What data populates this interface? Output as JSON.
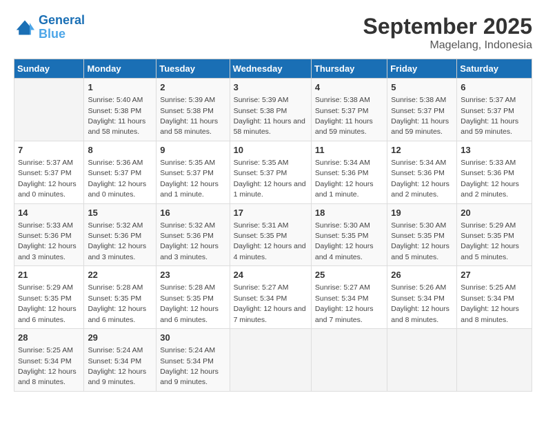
{
  "header": {
    "logo_general": "General",
    "logo_blue": "Blue",
    "month_year": "September 2025",
    "location": "Magelang, Indonesia"
  },
  "days_of_week": [
    "Sunday",
    "Monday",
    "Tuesday",
    "Wednesday",
    "Thursday",
    "Friday",
    "Saturday"
  ],
  "weeks": [
    [
      {
        "day": "",
        "sunrise": "",
        "sunset": "",
        "daylight": ""
      },
      {
        "day": "1",
        "sunrise": "5:40 AM",
        "sunset": "5:38 PM",
        "daylight": "11 hours and 58 minutes."
      },
      {
        "day": "2",
        "sunrise": "5:39 AM",
        "sunset": "5:38 PM",
        "daylight": "11 hours and 58 minutes."
      },
      {
        "day": "3",
        "sunrise": "5:39 AM",
        "sunset": "5:38 PM",
        "daylight": "11 hours and 58 minutes."
      },
      {
        "day": "4",
        "sunrise": "5:38 AM",
        "sunset": "5:37 PM",
        "daylight": "11 hours and 59 minutes."
      },
      {
        "day": "5",
        "sunrise": "5:38 AM",
        "sunset": "5:37 PM",
        "daylight": "11 hours and 59 minutes."
      },
      {
        "day": "6",
        "sunrise": "5:37 AM",
        "sunset": "5:37 PM",
        "daylight": "11 hours and 59 minutes."
      }
    ],
    [
      {
        "day": "7",
        "sunrise": "5:37 AM",
        "sunset": "5:37 PM",
        "daylight": "12 hours and 0 minutes."
      },
      {
        "day": "8",
        "sunrise": "5:36 AM",
        "sunset": "5:37 PM",
        "daylight": "12 hours and 0 minutes."
      },
      {
        "day": "9",
        "sunrise": "5:35 AM",
        "sunset": "5:37 PM",
        "daylight": "12 hours and 1 minute."
      },
      {
        "day": "10",
        "sunrise": "5:35 AM",
        "sunset": "5:37 PM",
        "daylight": "12 hours and 1 minute."
      },
      {
        "day": "11",
        "sunrise": "5:34 AM",
        "sunset": "5:36 PM",
        "daylight": "12 hours and 1 minute."
      },
      {
        "day": "12",
        "sunrise": "5:34 AM",
        "sunset": "5:36 PM",
        "daylight": "12 hours and 2 minutes."
      },
      {
        "day": "13",
        "sunrise": "5:33 AM",
        "sunset": "5:36 PM",
        "daylight": "12 hours and 2 minutes."
      }
    ],
    [
      {
        "day": "14",
        "sunrise": "5:33 AM",
        "sunset": "5:36 PM",
        "daylight": "12 hours and 3 minutes."
      },
      {
        "day": "15",
        "sunrise": "5:32 AM",
        "sunset": "5:36 PM",
        "daylight": "12 hours and 3 minutes."
      },
      {
        "day": "16",
        "sunrise": "5:32 AM",
        "sunset": "5:36 PM",
        "daylight": "12 hours and 3 minutes."
      },
      {
        "day": "17",
        "sunrise": "5:31 AM",
        "sunset": "5:35 PM",
        "daylight": "12 hours and 4 minutes."
      },
      {
        "day": "18",
        "sunrise": "5:30 AM",
        "sunset": "5:35 PM",
        "daylight": "12 hours and 4 minutes."
      },
      {
        "day": "19",
        "sunrise": "5:30 AM",
        "sunset": "5:35 PM",
        "daylight": "12 hours and 5 minutes."
      },
      {
        "day": "20",
        "sunrise": "5:29 AM",
        "sunset": "5:35 PM",
        "daylight": "12 hours and 5 minutes."
      }
    ],
    [
      {
        "day": "21",
        "sunrise": "5:29 AM",
        "sunset": "5:35 PM",
        "daylight": "12 hours and 6 minutes."
      },
      {
        "day": "22",
        "sunrise": "5:28 AM",
        "sunset": "5:35 PM",
        "daylight": "12 hours and 6 minutes."
      },
      {
        "day": "23",
        "sunrise": "5:28 AM",
        "sunset": "5:35 PM",
        "daylight": "12 hours and 6 minutes."
      },
      {
        "day": "24",
        "sunrise": "5:27 AM",
        "sunset": "5:34 PM",
        "daylight": "12 hours and 7 minutes."
      },
      {
        "day": "25",
        "sunrise": "5:27 AM",
        "sunset": "5:34 PM",
        "daylight": "12 hours and 7 minutes."
      },
      {
        "day": "26",
        "sunrise": "5:26 AM",
        "sunset": "5:34 PM",
        "daylight": "12 hours and 8 minutes."
      },
      {
        "day": "27",
        "sunrise": "5:25 AM",
        "sunset": "5:34 PM",
        "daylight": "12 hours and 8 minutes."
      }
    ],
    [
      {
        "day": "28",
        "sunrise": "5:25 AM",
        "sunset": "5:34 PM",
        "daylight": "12 hours and 8 minutes."
      },
      {
        "day": "29",
        "sunrise": "5:24 AM",
        "sunset": "5:34 PM",
        "daylight": "12 hours and 9 minutes."
      },
      {
        "day": "30",
        "sunrise": "5:24 AM",
        "sunset": "5:34 PM",
        "daylight": "12 hours and 9 minutes."
      },
      {
        "day": "",
        "sunrise": "",
        "sunset": "",
        "daylight": ""
      },
      {
        "day": "",
        "sunrise": "",
        "sunset": "",
        "daylight": ""
      },
      {
        "day": "",
        "sunrise": "",
        "sunset": "",
        "daylight": ""
      },
      {
        "day": "",
        "sunrise": "",
        "sunset": "",
        "daylight": ""
      }
    ]
  ],
  "labels": {
    "sunrise_prefix": "Sunrise: ",
    "sunset_prefix": "Sunset: ",
    "daylight_prefix": "Daylight: "
  }
}
